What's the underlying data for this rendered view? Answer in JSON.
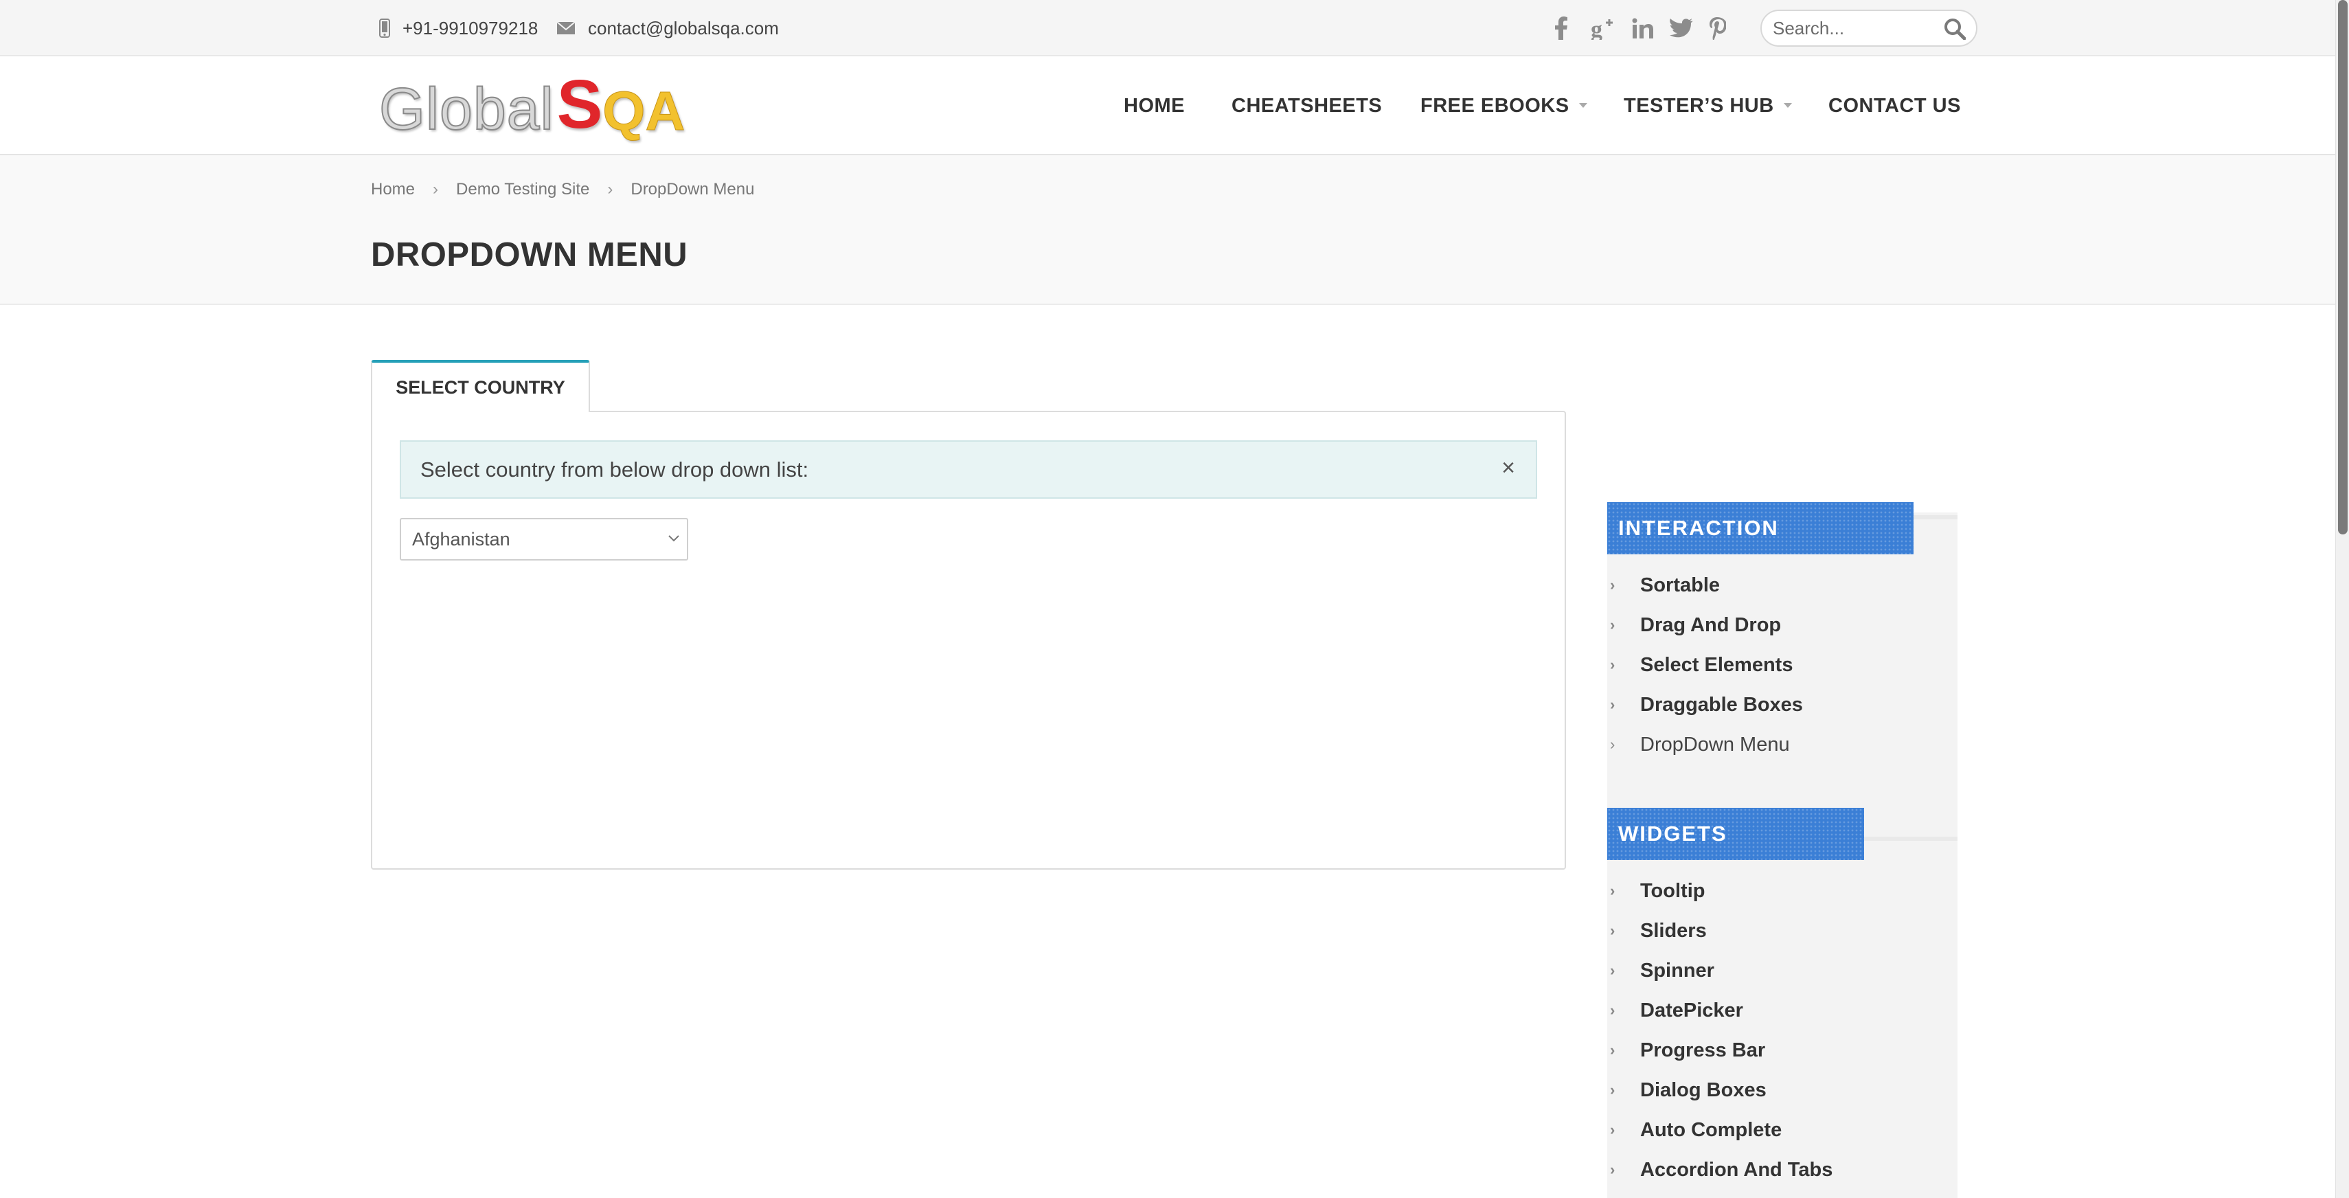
{
  "topbar": {
    "phone": "+91-9910979218",
    "email": "contact@globalsqa.com",
    "social_icons": [
      "facebook-icon",
      "google-plus-icon",
      "linkedin-icon",
      "twitter-icon",
      "pinterest-icon"
    ],
    "search_placeholder": "Search..."
  },
  "header": {
    "logo": {
      "part1": "Global",
      "part2": "S",
      "part3": "QA"
    },
    "nav": {
      "home": "HOME",
      "cheatsheets": "CHEATSHEETS",
      "free_ebooks": "FREE EBOOKS",
      "testers_hub": "TESTER’S HUB",
      "contact_us": "CONTACT US"
    }
  },
  "breadcrumb": {
    "home": "Home",
    "demo": "Demo Testing Site",
    "current": "DropDown Menu"
  },
  "page_title": "DROPDOWN MENU",
  "main": {
    "tab_label": "SELECT COUNTRY",
    "alert_text": "Select country from below drop down list:",
    "alert_close": "×",
    "country_select_value": "Afghanistan"
  },
  "sidebar": {
    "interaction_heading": "INTERACTION",
    "interaction_items": [
      "Sortable",
      "Drag And Drop",
      "Select Elements",
      "Draggable Boxes",
      "DropDown Menu"
    ],
    "interaction_current": "DropDown Menu",
    "widgets_heading": "WIDGETS",
    "widgets_items": [
      "Tooltip",
      "Sliders",
      "Spinner",
      "DatePicker",
      "Progress Bar",
      "Dialog Boxes",
      "Auto Complete",
      "Accordion And Tabs"
    ]
  },
  "colors": {
    "accent_tab": "#26a0b8",
    "sidebar_heading": "#3b7fd6",
    "alert_bg": "#e8f4f4",
    "logo_red": "#e0262b",
    "logo_yellow": "#f2c12e"
  }
}
